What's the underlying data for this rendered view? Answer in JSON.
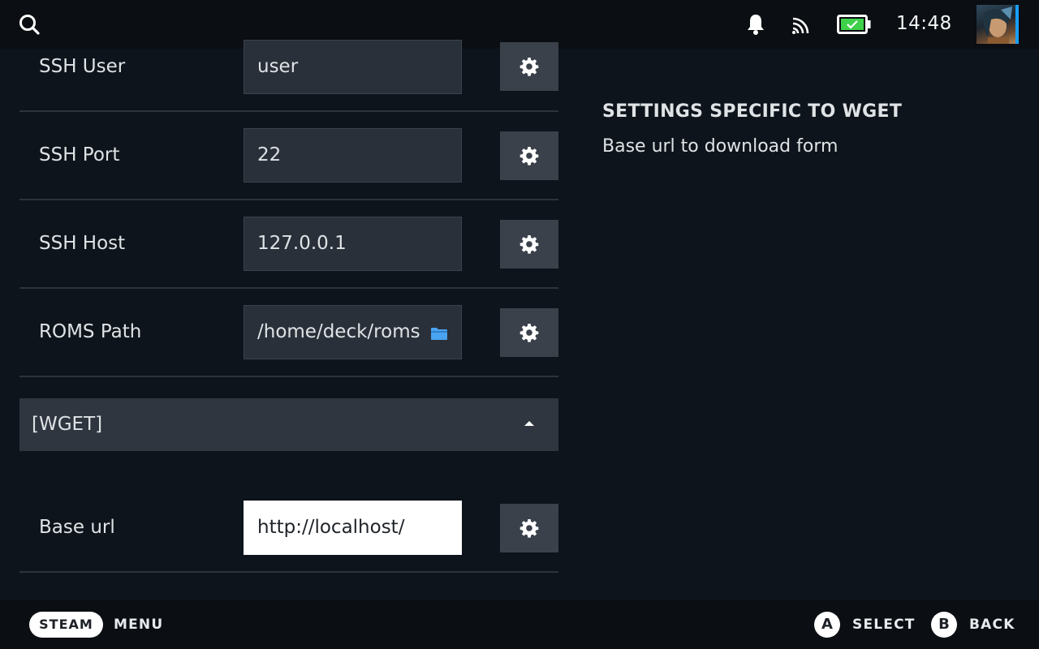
{
  "status": {
    "time": "14:48"
  },
  "settings": [
    {
      "label": "SSH User",
      "value": "user"
    },
    {
      "label": "SSH Port",
      "value": "22"
    },
    {
      "label": "SSH Host",
      "value": "127.0.0.1"
    },
    {
      "label": "ROMS Path",
      "value": "/home/deck/roms"
    }
  ],
  "section": {
    "label": "[WGET]"
  },
  "wget": {
    "label": "Base url",
    "value": "http://localhost/"
  },
  "description": {
    "title": "SETTINGS SPECIFIC TO WGET",
    "text": "Base url to download form"
  },
  "footer": {
    "steam_label": "STEAM",
    "menu_label": "MENU",
    "a_button": "A",
    "select_label": "SELECT",
    "b_button": "B",
    "back_label": "BACK"
  },
  "colors": {
    "accent": "#1a9fff",
    "battery_fill": "#3fd14a",
    "folder": "#4aa3f0"
  }
}
